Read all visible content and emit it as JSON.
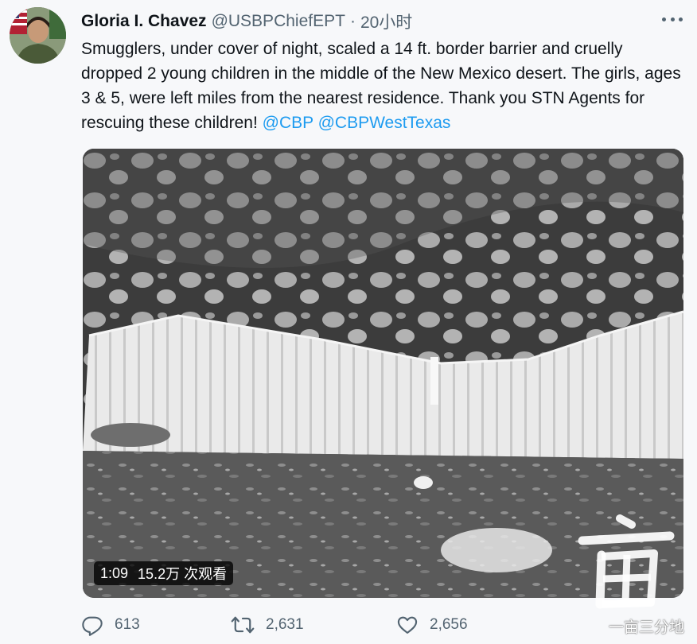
{
  "tweet": {
    "author_name": "Gloria I. Chavez",
    "handle": "@USBPChiefEPT",
    "separator": "·",
    "time": "20小时",
    "text_main": "Smugglers, under cover of night, scaled a 14 ft. border barrier and cruelly dropped 2 young children in the middle of the New Mexico desert. The girls, ages 3 & 5, were left miles from the nearest residence. Thank you STN Agents for rescuing these children! ",
    "mention_1": "@CBP",
    "mention_2": "@CBPWestTexas"
  },
  "video": {
    "duration": "1:09",
    "views": "15.2万 次观看"
  },
  "actions": {
    "reply_count": "613",
    "retweet_count": "2,631",
    "like_count": "2,656"
  },
  "watermark": {
    "glyph": "亩",
    "text": "一亩三分地"
  },
  "icons": {
    "reply": "reply-icon",
    "retweet": "retweet-icon",
    "like": "heart-icon",
    "more": "more-icon"
  },
  "colors": {
    "link": "#1d9bf0",
    "secondary": "#536471",
    "background": "#f7f8fa"
  }
}
